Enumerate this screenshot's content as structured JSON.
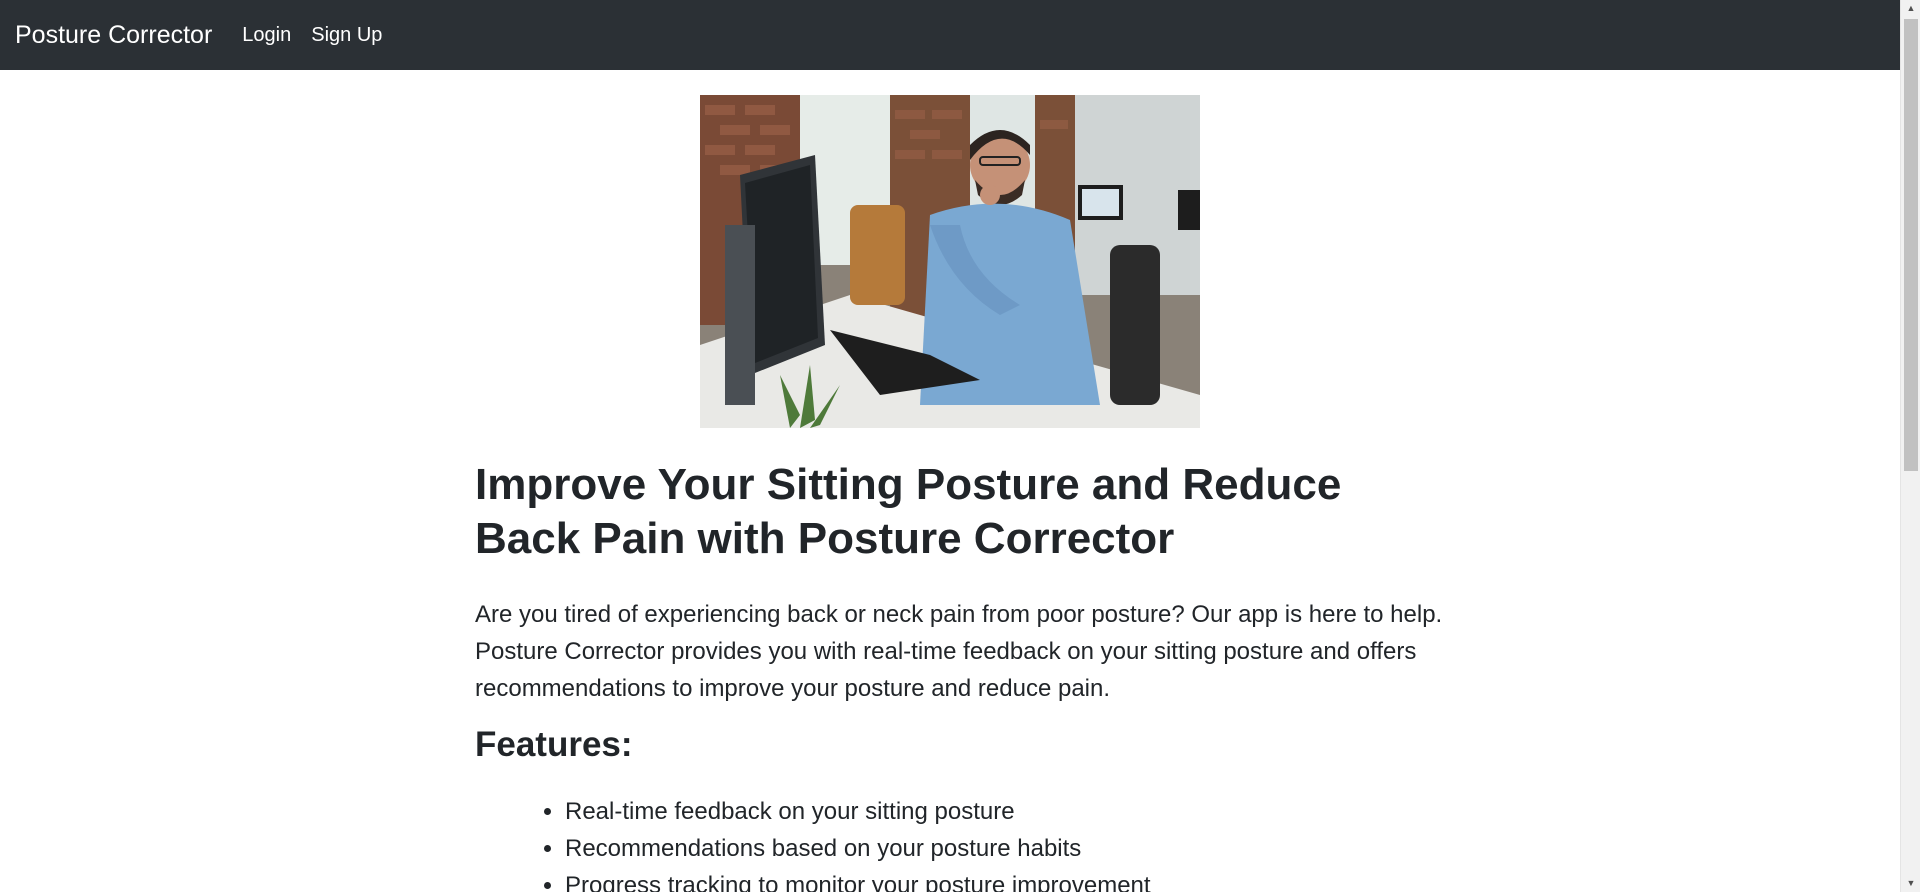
{
  "navbar": {
    "brand": "Posture Corrector",
    "links": [
      "Login",
      "Sign Up"
    ]
  },
  "hero": {
    "alt": "Man working at desk with computer in office"
  },
  "main": {
    "headline": "Improve Your Sitting Posture and Reduce Back Pain with Posture Corrector",
    "intro": "Are you tired of experiencing back or neck pain from poor posture? Our app is here to help. Posture Corrector provides you with real-time feedback on your sitting posture and offers recommendations to improve your posture and reduce pain.",
    "features_heading": "Features:",
    "features": [
      "Real-time feedback on your sitting posture",
      "Recommendations based on your posture habits",
      "Progress tracking to monitor your posture improvement"
    ]
  },
  "colors": {
    "navbar_bg": "#2b3035",
    "text": "#212529"
  },
  "icons": {
    "scroll_up": "arrow-up-icon",
    "scroll_down": "arrow-down-icon"
  }
}
